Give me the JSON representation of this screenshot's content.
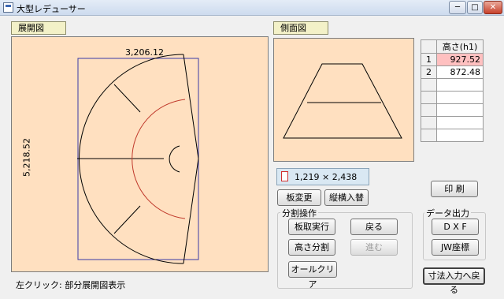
{
  "window": {
    "title": "大型レデューサー",
    "minimize": "─",
    "maximize": "□",
    "close": "✕"
  },
  "development": {
    "label": "展開図",
    "top_dim": "3,206.12",
    "side_dim": "5,218.52"
  },
  "side_view": {
    "label": "側面図"
  },
  "height_table": {
    "header": "高さ(h1)",
    "rows": [
      {
        "no": "1",
        "value": "927.52"
      },
      {
        "no": "2",
        "value": "872.48"
      },
      {
        "no": "",
        "value": ""
      },
      {
        "no": "",
        "value": ""
      },
      {
        "no": "",
        "value": ""
      },
      {
        "no": "",
        "value": ""
      },
      {
        "no": "",
        "value": ""
      }
    ]
  },
  "board": {
    "size": "1,219 × 2,438",
    "change_label": "板変更",
    "swap_label": "縦横入替"
  },
  "split_ops": {
    "label": "分割操作",
    "execute_label": "板取実行",
    "back_label": "戻る",
    "height_split_label": "高さ分割",
    "forward_label": "進む",
    "all_clear_label": "オールクリア"
  },
  "print_label": "印 刷",
  "data_output": {
    "label": "データ出力",
    "dxf_label": "D X F",
    "jw_label": "JW座標"
  },
  "return_label": "寸法入力へ戻る",
  "status": "左クリック: 部分展開図表示"
}
